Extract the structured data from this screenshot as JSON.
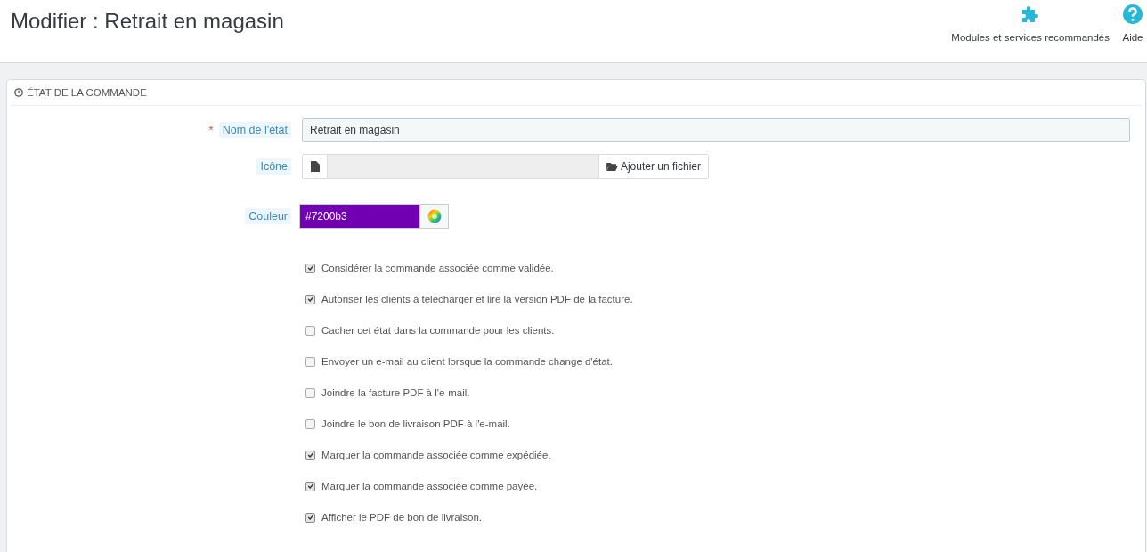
{
  "page_title": "Modifier : Retrait en magasin",
  "toolbar": [
    {
      "kind": "modules",
      "label": "Modules et services recommandés"
    },
    {
      "kind": "help",
      "label": "Aide"
    }
  ],
  "panel": {
    "title": "ÉTAT DE LA COMMANDE",
    "name_field": {
      "required_mark": "*",
      "label": "Nom de l'état",
      "value": "Retrait en magasin"
    },
    "icon_field": {
      "label": "Icône",
      "button": "Ajouter un fichier"
    },
    "color_field": {
      "label": "Couleur",
      "value": "#7200b3"
    },
    "options": [
      {
        "label": "Considérer la commande associée comme validée.",
        "checked": true
      },
      {
        "label": "Autoriser les clients à télécharger et lire la version PDF de la facture.",
        "checked": true
      },
      {
        "label": "Cacher cet état dans la commande pour les clients.",
        "checked": false
      },
      {
        "label": "Envoyer un e-mail au client lorsque la commande change d'état.",
        "checked": false
      },
      {
        "label": "Joindre la facture PDF à l'e-mail.",
        "checked": false
      },
      {
        "label": "Joindre le bon de livraison PDF à l'e-mail.",
        "checked": false
      },
      {
        "label": "Marquer la commande associée comme expédiée.",
        "checked": true
      },
      {
        "label": "Marquer la commande associée comme payée.",
        "checked": true
      },
      {
        "label": "Afficher le PDF de bon de livraison.",
        "checked": true
      }
    ]
  }
}
